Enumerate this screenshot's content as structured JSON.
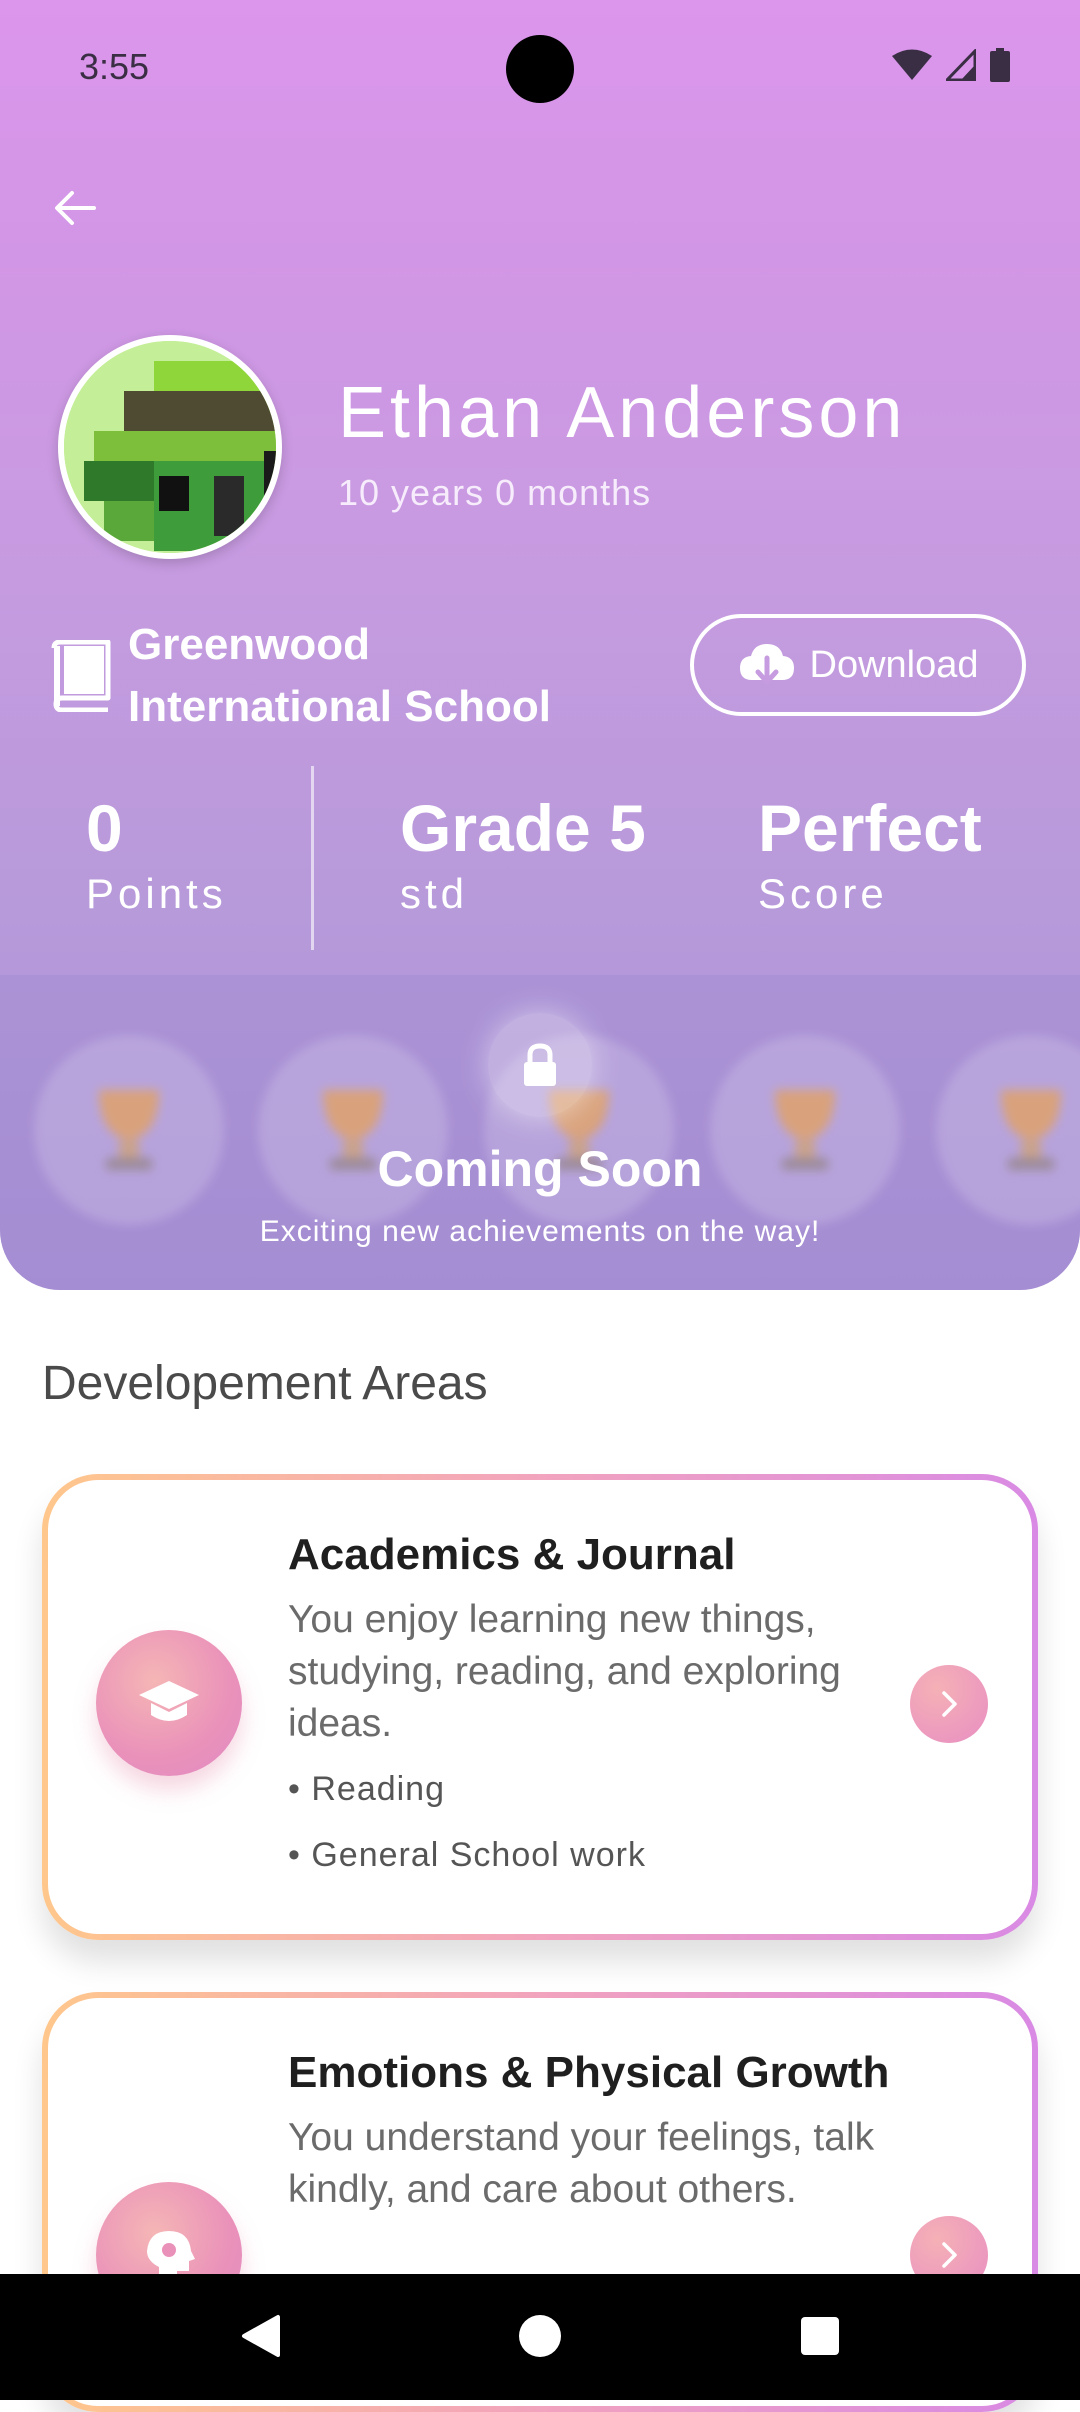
{
  "status_bar": {
    "time": "3:55"
  },
  "profile": {
    "name": "Ethan Anderson",
    "age": "10 years 0 months",
    "school_line1": "Greenwood",
    "school_line2": "International School",
    "download_label": "Download"
  },
  "stats": [
    {
      "value": "0",
      "label": "Points"
    },
    {
      "value": "Grade 5",
      "label": "std"
    },
    {
      "value": "Perfect",
      "label": "Score"
    }
  ],
  "achievements": {
    "title": "Coming Soon",
    "subtitle": "Exciting new achievements on the way!"
  },
  "section_title": "Developement Areas",
  "cards": [
    {
      "title": "Academics & Journal",
      "description": "You enjoy learning new things, studying, reading, and exploring ideas.",
      "bullets": [
        "• Reading",
        "• General School work"
      ],
      "icon": "graduation-cap-icon"
    },
    {
      "title": "Emotions & Physical Growth",
      "description": "You understand your feelings, talk kindly, and care about others.",
      "icon": "brain-gear-icon"
    }
  ],
  "colors": {
    "header_top": "#dc96ec",
    "header_bottom": "#a98fd3",
    "card_border_start": "#ffc78c",
    "card_border_end": "#d98ae4",
    "accent_pink": "#e88ec2"
  }
}
